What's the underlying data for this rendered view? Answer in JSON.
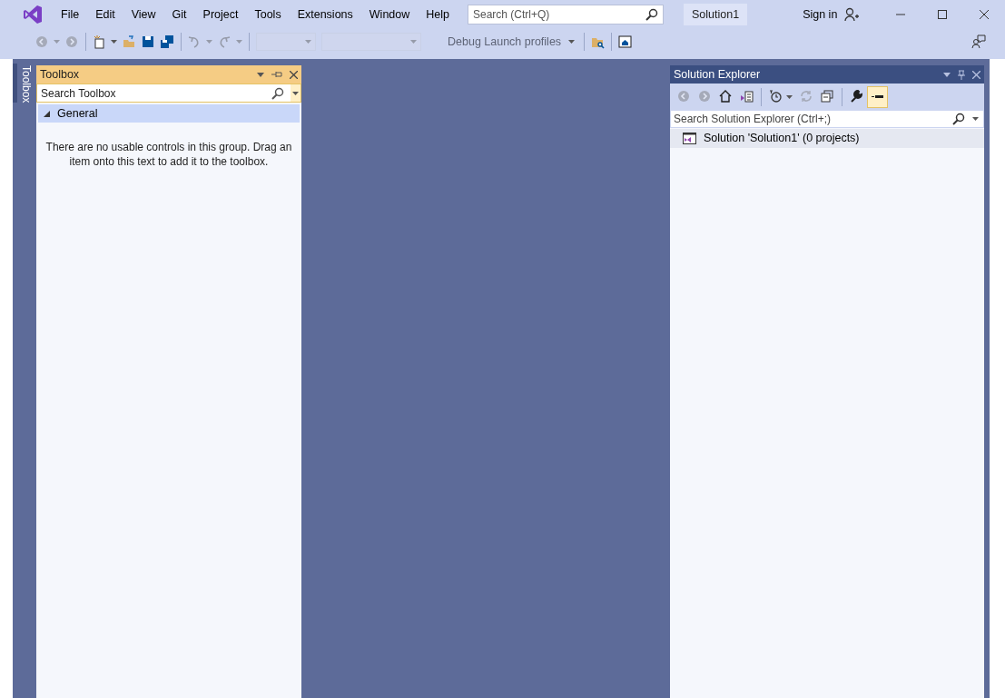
{
  "window": {
    "title": "Solution1"
  },
  "menu": [
    {
      "label": "File"
    },
    {
      "label": "Edit"
    },
    {
      "label": "View"
    },
    {
      "label": "Git"
    },
    {
      "label": "Project"
    },
    {
      "label": "Tools"
    },
    {
      "label": "Extensions"
    },
    {
      "label": "Window"
    },
    {
      "label": "Help"
    }
  ],
  "search": {
    "placeholder": "Search (Ctrl+Q)"
  },
  "account": {
    "label": "Sign in"
  },
  "main_toolbar": [
    {
      "kind": "back",
      "disabled": true
    },
    {
      "kind": "forward",
      "disabled": true
    },
    {
      "kind": "new",
      "disabled": false
    },
    {
      "kind": "open",
      "disabled": false
    },
    {
      "kind": "save",
      "disabled": false
    },
    {
      "kind": "save-all",
      "disabled": false
    },
    {
      "kind": "undo",
      "disabled": true
    },
    {
      "kind": "redo",
      "disabled": true
    },
    {
      "kind": "combo",
      "disabled": true
    },
    {
      "kind": "combo-wide",
      "disabled": true
    },
    {
      "kind": "launch",
      "label": "Debug Launch profiles",
      "disabled": true
    },
    {
      "kind": "find-files",
      "disabled": false
    },
    {
      "kind": "layout",
      "disabled": false
    }
  ],
  "toolbox": {
    "tab_label": "Toolbox",
    "title": "Toolbox",
    "search": {
      "placeholder": "Search Toolbox"
    },
    "groups": [
      {
        "label": "General",
        "expanded": true,
        "message": "There are no usable controls in this group. Drag an item onto this text to add it to the toolbox."
      }
    ]
  },
  "solution_explorer": {
    "title": "Solution Explorer",
    "toolbar": [
      {
        "kind": "back",
        "disabled": true,
        "on": false
      },
      {
        "kind": "forward",
        "disabled": true,
        "on": false
      },
      {
        "kind": "home",
        "disabled": false,
        "on": false
      },
      {
        "kind": "switch-views",
        "disabled": false,
        "on": false
      },
      {
        "kind": "pending",
        "disabled": false,
        "on": false
      },
      {
        "kind": "sync",
        "disabled": true,
        "on": false
      },
      {
        "kind": "collapse",
        "disabled": false,
        "on": false
      },
      {
        "kind": "properties",
        "disabled": false,
        "on": false
      },
      {
        "kind": "preview",
        "disabled": false,
        "on": true
      }
    ],
    "search": {
      "placeholder": "Search Solution Explorer (Ctrl+;)"
    },
    "tree": [
      {
        "label": "Solution 'Solution1' (0 projects)",
        "selected": true
      }
    ]
  }
}
